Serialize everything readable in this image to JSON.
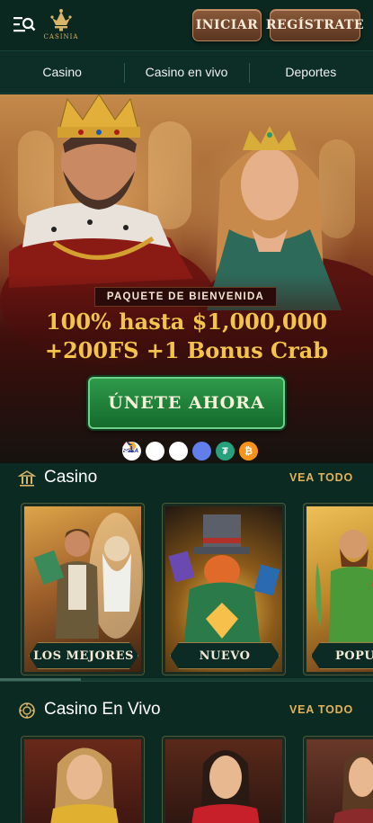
{
  "header": {
    "logo_text": "CASINIA",
    "login_label": "INICIAR",
    "register_label": "REGÍSTRATE"
  },
  "nav": {
    "tabs": [
      {
        "label": "Casino"
      },
      {
        "label": "Casino en vivo"
      },
      {
        "label": "Deportes"
      }
    ]
  },
  "hero": {
    "badge": "PAQUETE DE BIENVENIDA",
    "line1": "100% hasta $1,000,000",
    "line2": "+200FS +1 Bonus Crab",
    "cta_label": "ÚNETE AHORA",
    "payment_icons": [
      "visa-icon",
      "mastercard-icon",
      "bank-icon",
      "ethereum-icon",
      "tether-icon",
      "bitcoin-icon"
    ]
  },
  "sections": {
    "casino": {
      "title": "Casino",
      "link": "VEA TODO",
      "cards": [
        {
          "label": "LOS MEJORES"
        },
        {
          "label": "NUEVO"
        },
        {
          "label": "POPULAR"
        }
      ]
    },
    "live": {
      "title": "Casino En Vivo",
      "link": "VEA TODO"
    }
  },
  "colors": {
    "background": "#0b2a22",
    "accent_gold": "#e2b35c",
    "promo_gold": "#f4c44a",
    "cta_green": "#1f8a3c",
    "button_brown": "#6f4429"
  }
}
